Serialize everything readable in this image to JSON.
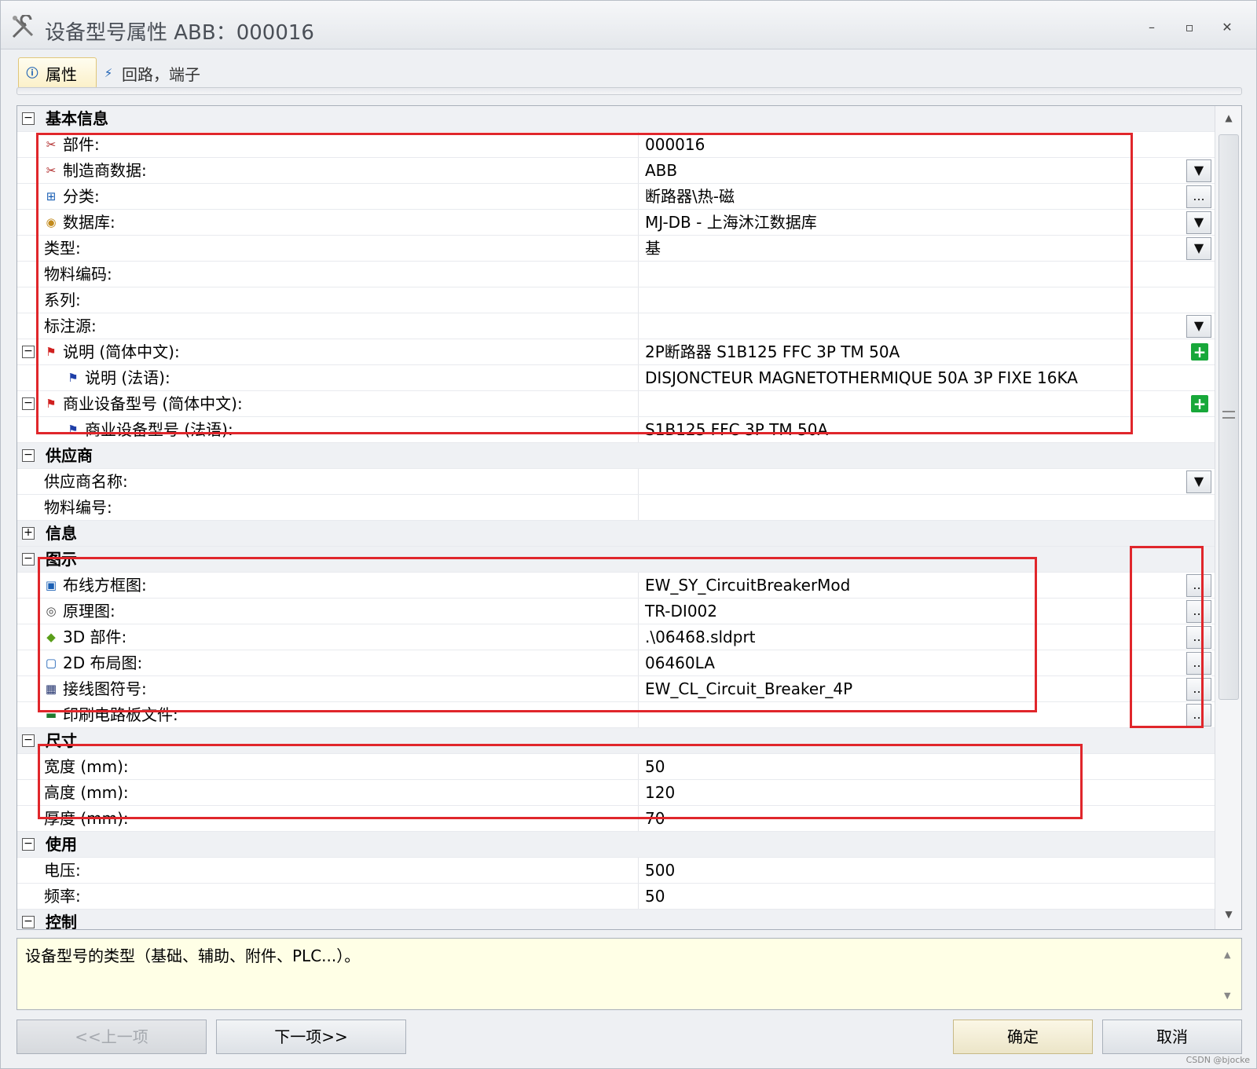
{
  "window": {
    "title": "设备型号属性 ABB：000016",
    "minimize": "–",
    "maximize": "▫",
    "close": "✕"
  },
  "tabs": [
    {
      "label": "属性",
      "icon": "info-icon"
    },
    {
      "label": "回路，端子",
      "icon": "circuit-icon"
    }
  ],
  "sections": {
    "basic": {
      "title": "基本信息",
      "rows": {
        "part": {
          "label": "部件:",
          "value": "000016"
        },
        "manufacturer": {
          "label": "制造商数据:",
          "value": "ABB"
        },
        "classification": {
          "label": "分类:",
          "value": "断路器\\热-磁"
        },
        "database": {
          "label": "数据库:",
          "value": "MJ-DB - 上海沐江数据库"
        },
        "type": {
          "label": "类型:",
          "value": "基"
        },
        "material_code": {
          "label": "物料编码:",
          "value": ""
        },
        "series": {
          "label": "系列:",
          "value": ""
        },
        "mark_source": {
          "label": "标注源:",
          "value": ""
        },
        "desc_zh": {
          "label": "说明 (简体中文):",
          "value": "2P断路器  S1B125 FFC 3P TM 50A"
        },
        "desc_fr": {
          "label": "说明 (法语):",
          "value": "DISJONCTEUR MAGNETOTHERMIQUE 50A 3P FIXE 16KA"
        },
        "model_zh": {
          "label": "商业设备型号 (简体中文):",
          "value": ""
        },
        "model_fr": {
          "label": "商业设备型号 (法语):",
          "value": "S1B125 FFC 3P TM 50A"
        }
      }
    },
    "supplier": {
      "title": "供应商",
      "rows": {
        "name": {
          "label": "供应商名称:",
          "value": ""
        },
        "number": {
          "label": "物料编号:",
          "value": ""
        }
      }
    },
    "info": {
      "title": "信息"
    },
    "graphics": {
      "title": "图示",
      "rows": {
        "wiring_block": {
          "label": "布线方框图:",
          "value": "EW_SY_CircuitBreakerMod"
        },
        "schematic": {
          "label": "原理图:",
          "value": "TR-DI002"
        },
        "part3d": {
          "label": "3D 部件:",
          "value": ".\\06468.sldprt"
        },
        "layout2d": {
          "label": "2D 布局图:",
          "value": "06460LA"
        },
        "wiring_symbol": {
          "label": "接线图符号:",
          "value": "EW_CL_Circuit_Breaker_4P"
        },
        "pcb": {
          "label": "印刷电路板文件:",
          "value": ""
        }
      }
    },
    "dimensions": {
      "title": "尺寸",
      "rows": {
        "width": {
          "label": "宽度 (mm):",
          "value": "50"
        },
        "height": {
          "label": "高度 (mm):",
          "value": "120"
        },
        "thickness": {
          "label": "厚度 (mm):",
          "value": "70"
        }
      }
    },
    "usage": {
      "title": "使用",
      "rows": {
        "voltage": {
          "label": "电压:",
          "value": "500"
        },
        "frequency": {
          "label": "频率:",
          "value": "50"
        }
      }
    },
    "control": {
      "title": "控制"
    }
  },
  "description": "设备型号的类型（基础、辅助、附件、PLC...）。",
  "buttons": {
    "prev": "<<上一项",
    "next": "下一项>>",
    "ok": "确定",
    "cancel": "取消",
    "browse": "...",
    "add": "+",
    "dropdown": "▼"
  },
  "watermark": "CSDN @bjocke",
  "colors": {
    "highlight_box": "#e0262b",
    "description_bg": "#ffffe6",
    "category_bg": "#eff1f4"
  }
}
